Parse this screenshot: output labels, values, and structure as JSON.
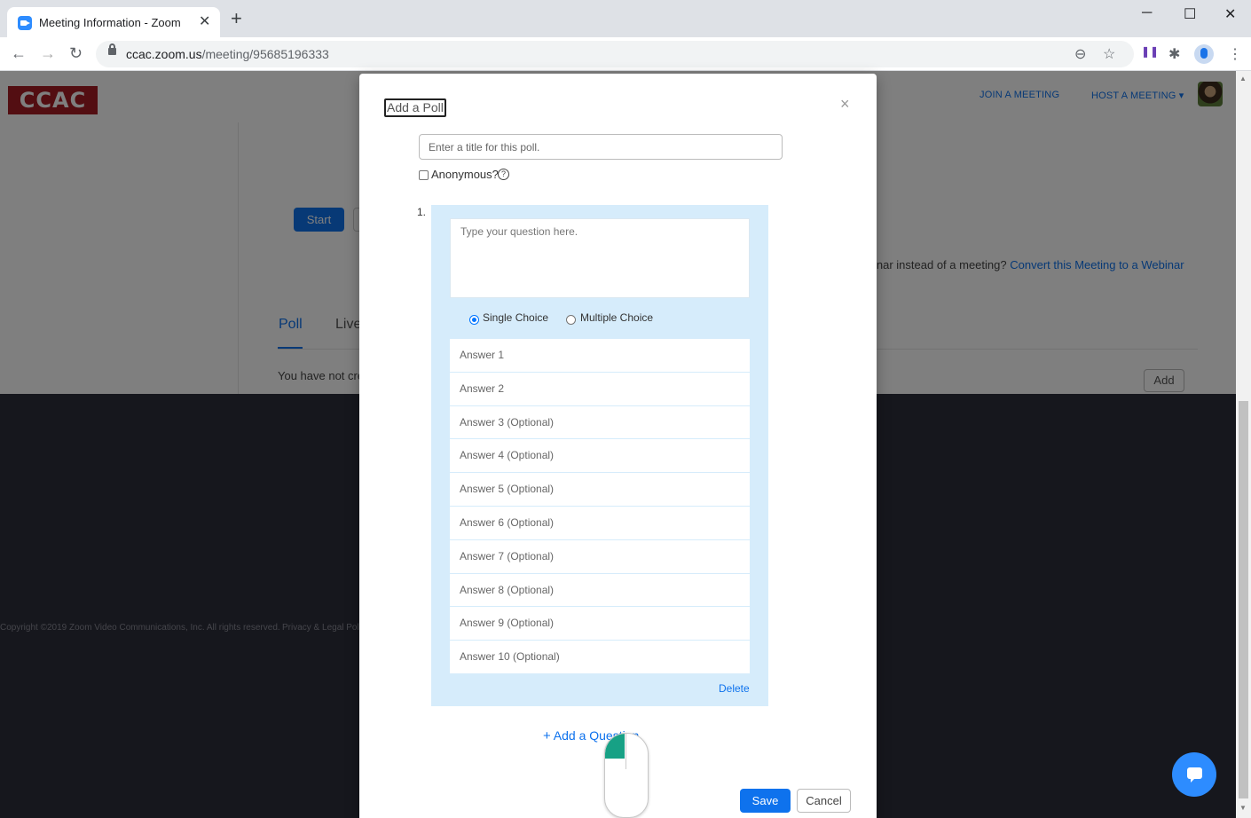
{
  "browser": {
    "tab_title": "Meeting Information - Zoom",
    "tab_close": "✕",
    "new_tab": "+",
    "url_host": "ccac.zoom.us",
    "url_path": "/meeting/95685196333",
    "window": {
      "minimize": "─",
      "maximize": "☐",
      "close": "✕"
    },
    "nav": {
      "back": "←",
      "forward": "→",
      "reload": "↻"
    },
    "omni": {
      "zoom": "⊖",
      "star": "☆"
    },
    "ext": {
      "extension": "❚❚",
      "puzzle": "✱",
      "menu": "⋮"
    }
  },
  "header": {
    "logo": "CCAC",
    "join_meeting": "JOIN A MEETING",
    "host_meeting": "HOST A MEETING ▾"
  },
  "content": {
    "start_button": "Start",
    "webinar_prefix": "inar instead of a meeting?",
    "webinar_link": "Convert this Meeting to a Webinar",
    "tabs": {
      "poll": "Poll",
      "live": "Live"
    },
    "empty_text": "You have not created",
    "add_button": "Add"
  },
  "footer": {
    "copyright": "Copyright ©2019 Zoom Video Communications, Inc. All rights reserved.",
    "privacy": "Privacy & Legal Poli"
  },
  "modal": {
    "title": "Add a Poll",
    "close": "×",
    "poll_title_placeholder": "Enter a title for this poll.",
    "anonymous_label": "Anonymous?",
    "help": "?",
    "question": {
      "number": "1.",
      "placeholder": "Type your question here.",
      "single_choice": "Single Choice",
      "multiple_choice": "Multiple Choice",
      "selected": "single",
      "answers": [
        "Answer 1",
        "Answer 2",
        "Answer 3 (Optional)",
        "Answer 4 (Optional)",
        "Answer 5 (Optional)",
        "Answer 6 (Optional)",
        "Answer 7 (Optional)",
        "Answer 8 (Optional)",
        "Answer 9 (Optional)",
        "Answer 10 (Optional)"
      ],
      "delete": "Delete"
    },
    "add_question_plus": "+",
    "add_question": "Add a Question",
    "save": "Save",
    "cancel": "Cancel"
  },
  "colors": {
    "accent": "#0e72ed",
    "question_card": "#d6ecfb",
    "logo_red": "#a61d24",
    "footer_bg": "#2d2e3a"
  },
  "scrollbar": {
    "up": "▲",
    "down": "▼"
  }
}
